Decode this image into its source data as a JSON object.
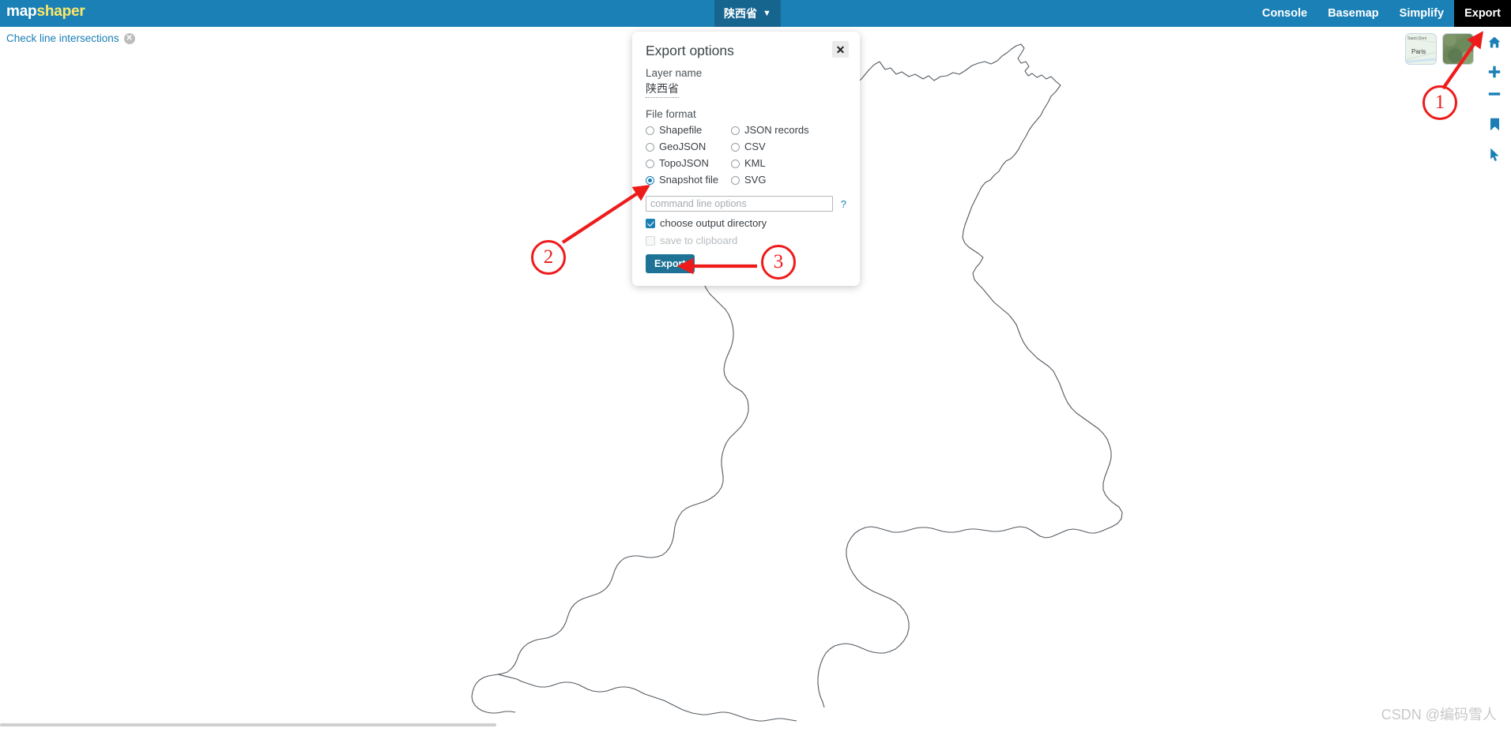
{
  "app": {
    "logo_map": "map",
    "logo_shaper": "shaper"
  },
  "topbar": {
    "layer_selector_label": "陕西省",
    "layer_selector_caret": "▼",
    "nav": [
      {
        "label": "Console",
        "active": false
      },
      {
        "label": "Basemap",
        "active": false
      },
      {
        "label": "Simplify",
        "active": false
      },
      {
        "label": "Export",
        "active": true
      }
    ]
  },
  "notice": {
    "label": "Check line intersections",
    "close_glyph": "✕"
  },
  "dialog": {
    "title": "Export options",
    "close_glyph": "✕",
    "layer_name_label": "Layer name",
    "layer_name_value": "陕西省",
    "file_format_label": "File format",
    "formats_left": [
      {
        "label": "Shapefile",
        "selected": false
      },
      {
        "label": "GeoJSON",
        "selected": false
      },
      {
        "label": "TopoJSON",
        "selected": false
      },
      {
        "label": "Snapshot file",
        "selected": true
      }
    ],
    "formats_right": [
      {
        "label": "JSON records",
        "selected": false
      },
      {
        "label": "CSV",
        "selected": false
      },
      {
        "label": "KML",
        "selected": false
      },
      {
        "label": "SVG",
        "selected": false
      }
    ],
    "command_placeholder": "command line options",
    "command_value": "",
    "help_glyph": "?",
    "checkbox_output_dir": {
      "label": "choose output directory",
      "checked": true,
      "disabled": false
    },
    "checkbox_clipboard": {
      "label": "save to clipboard",
      "checked": false,
      "disabled": true
    },
    "export_label": "Export"
  },
  "basemaps": [
    {
      "name": "street-basemap-thumbnail",
      "label_top": "Saint-Deni",
      "label_main": "Paris"
    },
    {
      "name": "satellite-basemap-thumbnail",
      "label_top": "",
      "label_main": ""
    }
  ],
  "map_tools": [
    {
      "name": "home-icon",
      "title": "home"
    },
    {
      "name": "zoom-in-icon",
      "title": "zoom in"
    },
    {
      "name": "zoom-out-icon",
      "title": "zoom out"
    },
    {
      "name": "bookmark-icon",
      "title": "bookmark"
    },
    {
      "name": "cursor-icon",
      "title": "pointer"
    }
  ],
  "annotations": [
    {
      "id": "1",
      "label": "1"
    },
    {
      "id": "2",
      "label": "2"
    },
    {
      "id": "3",
      "label": "3"
    }
  ],
  "watermark": {
    "text": "CSDN @编码雪人"
  },
  "colors": {
    "brand_blue": "#1a80b6",
    "accent_yellow": "#ffe866",
    "active_tab_bg": "#000000",
    "annotation_red": "#ee1b1b",
    "button_blue": "#1d7296",
    "map_stroke": "#545b62"
  }
}
